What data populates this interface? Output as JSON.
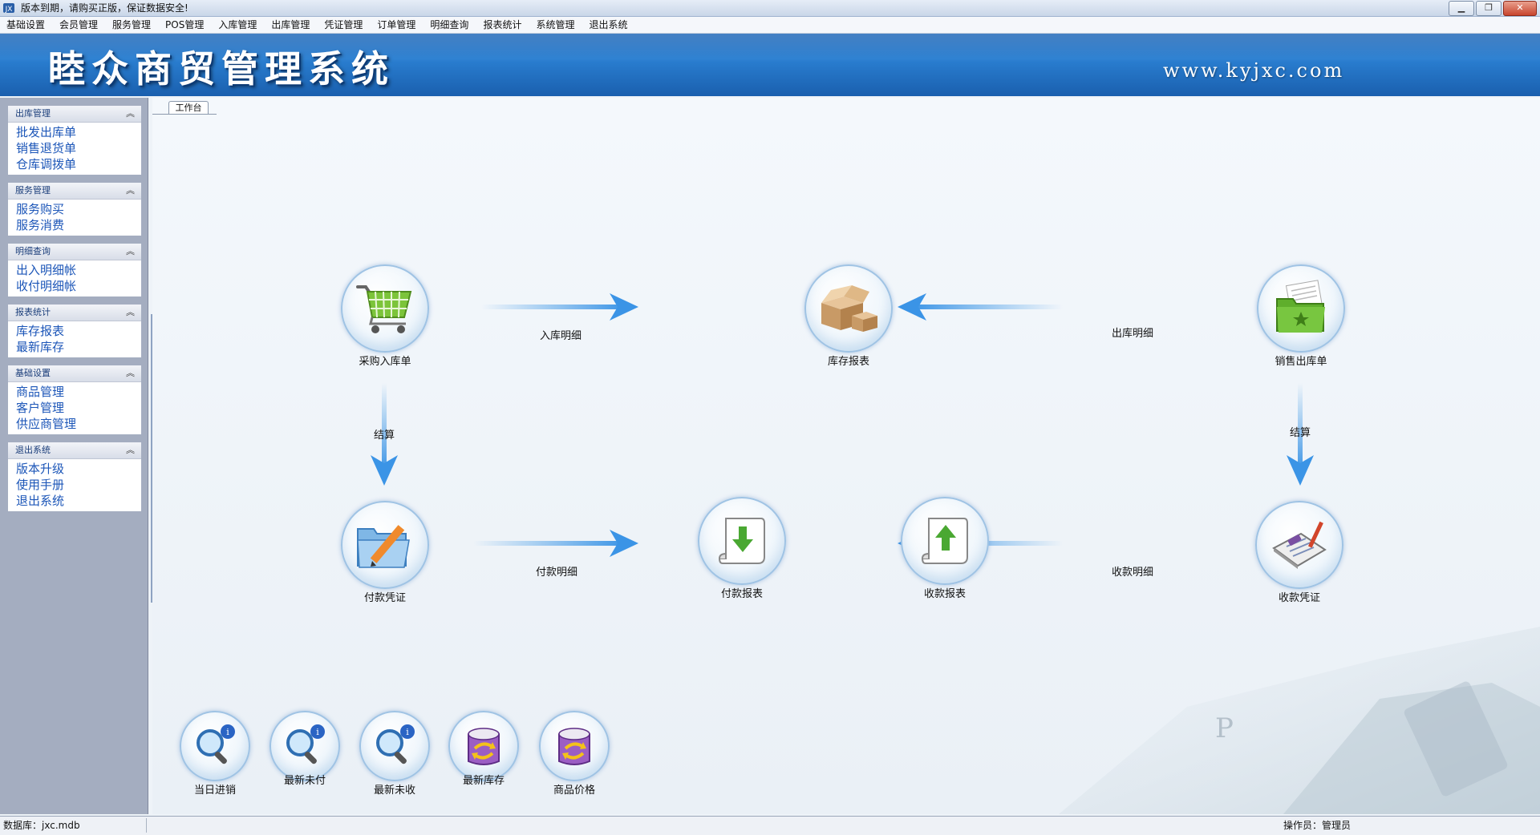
{
  "window": {
    "title": "版本到期，请购买正版，保证数据安全!",
    "controls": [
      "minimize",
      "restore",
      "close"
    ]
  },
  "menu": [
    "基础设置",
    "会员管理",
    "服务管理",
    "POS管理",
    "入库管理",
    "出库管理",
    "凭证管理",
    "订单管理",
    "明细查询",
    "报表统计",
    "系统管理",
    "退出系统"
  ],
  "banner": {
    "brand": "睦众商贸管理系统",
    "url": "www.kyjxc.com"
  },
  "sidebar": [
    {
      "title": "出库管理",
      "items": [
        "批发出库单",
        "销售退货单",
        "仓库调拨单"
      ]
    },
    {
      "title": "服务管理",
      "items": [
        "服务购买",
        "服务消费"
      ]
    },
    {
      "title": "明细查询",
      "items": [
        "出入明细帐",
        "收付明细帐"
      ]
    },
    {
      "title": "报表统计",
      "items": [
        "库存报表",
        "最新库存"
      ]
    },
    {
      "title": "基础设置",
      "items": [
        "商品管理",
        "客户管理",
        "供应商管理"
      ]
    },
    {
      "title": "退出系统",
      "items": [
        "版本升级",
        "使用手册",
        "退出系统"
      ]
    }
  ],
  "workspace": {
    "tab": "工作台",
    "nodes": {
      "purchase_in": "采购入库单",
      "stock_report": "库存报表",
      "sales_out": "销售出库单",
      "pay_voucher": "付款凭证",
      "pay_report": "付款报表",
      "receive_report": "收款报表",
      "receive_voucher": "收款凭证"
    },
    "arrows": {
      "in_detail": "入库明细",
      "out_detail": "出库明细",
      "settle_left": "结算",
      "settle_right": "结算",
      "pay_detail": "付款明细",
      "receive_detail": "收款明细"
    },
    "quick": [
      "当日进销",
      "最新未付",
      "最新未收",
      "最新库存",
      "商品价格"
    ]
  },
  "status": {
    "database": "数据库：jxc.mdb",
    "operator": "操作员：管理员"
  },
  "colors": {
    "banner": "#1b64b6",
    "sidebar_bg": "#a4adc0",
    "link": "#1c56b8",
    "arrow": "#4a9fe8"
  }
}
